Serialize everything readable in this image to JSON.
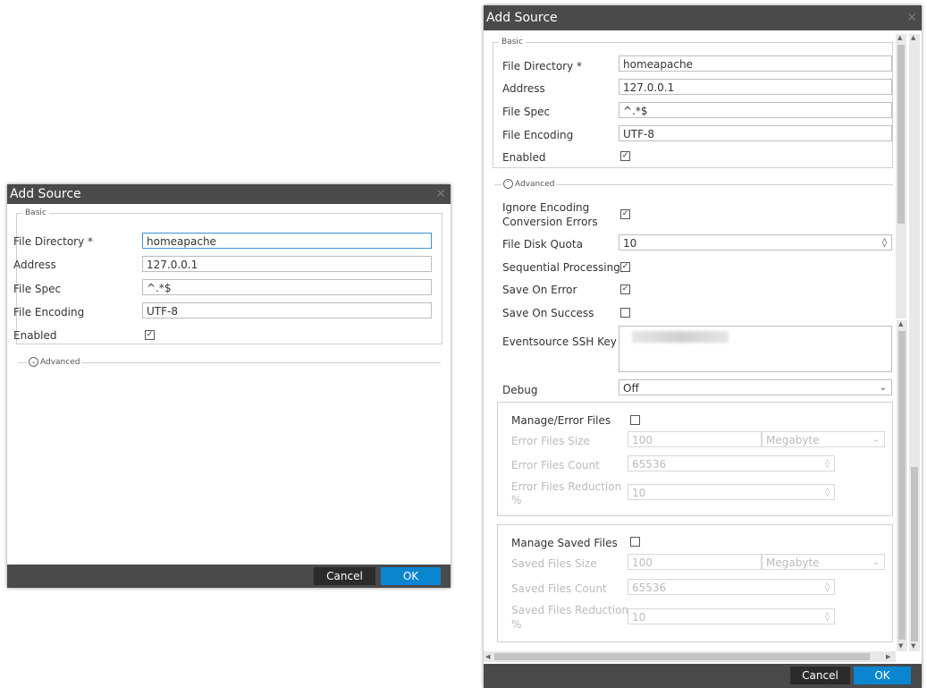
{
  "dialog_small": {
    "title": "Add Source",
    "close_icon": "close-icon",
    "basic_legend": "Basic",
    "fields": {
      "file_directory": {
        "label": "File Directory *",
        "value": "homeapache"
      },
      "address": {
        "label": "Address",
        "value": "127.0.0.1"
      },
      "file_spec": {
        "label": "File Spec",
        "value": "^.*$"
      },
      "file_encoding": {
        "label": "File Encoding",
        "value": "UTF-8"
      },
      "enabled": {
        "label": "Enabled",
        "check": "✓"
      }
    },
    "advanced_label": "Advanced",
    "cancel_label": "Cancel",
    "ok_label": "OK"
  },
  "dialog_large": {
    "title": "Add Source",
    "close_icon": "close-icon",
    "basic_legend": "Basic",
    "fields": {
      "file_directory": {
        "label": "File Directory *",
        "value": "homeapache"
      },
      "address": {
        "label": "Address",
        "value": "127.0.0.1"
      },
      "file_spec": {
        "label": "File Spec",
        "value": "^.*$"
      },
      "file_encoding": {
        "label": "File Encoding",
        "value": "UTF-8"
      },
      "enabled": {
        "label": "Enabled",
        "check": "✓"
      }
    },
    "advanced_legend": "Advanced",
    "advanced": {
      "ignore_encoding": {
        "label_line1": "Ignore Encoding",
        "label_line2": "Conversion Errors",
        "check": "✓"
      },
      "file_disk_quota": {
        "label": "File Disk Quota",
        "value": "10"
      },
      "sequential_processing": {
        "label": "Sequential Processing",
        "check": "✓"
      },
      "save_on_error": {
        "label": "Save On Error",
        "check": "✓"
      },
      "save_on_success": {
        "label": "Save On Success",
        "check": ""
      },
      "eventsource_ssh_key": {
        "label": "Eventsource SSH Key"
      },
      "debug": {
        "label": "Debug",
        "value": "Off"
      }
    },
    "error_files": {
      "manage_label": "Manage/Error Files",
      "size_label": "Error Files Size",
      "size_value": "100",
      "size_unit": "Megabyte",
      "count_label": "Error Files Count",
      "count_value": "65536",
      "reduction_label_line1": "Error Files Reduction",
      "reduction_label_line2": "%",
      "reduction_value": "10"
    },
    "saved_files": {
      "manage_label": "Manage Saved Files",
      "size_label": "Saved Files Size",
      "size_value": "100",
      "size_unit": "Megabyte",
      "count_label": "Saved Files Count",
      "count_value": "65536",
      "reduction_label_line1": "Saved Files Reduction",
      "reduction_label_line2": "%",
      "reduction_value": "10"
    },
    "cancel_label": "Cancel",
    "ok_label": "OK"
  },
  "colors": {
    "titlebar": "#4a4a4a",
    "ok_button": "#0a85d0",
    "cancel_button": "#2b2b2b"
  }
}
